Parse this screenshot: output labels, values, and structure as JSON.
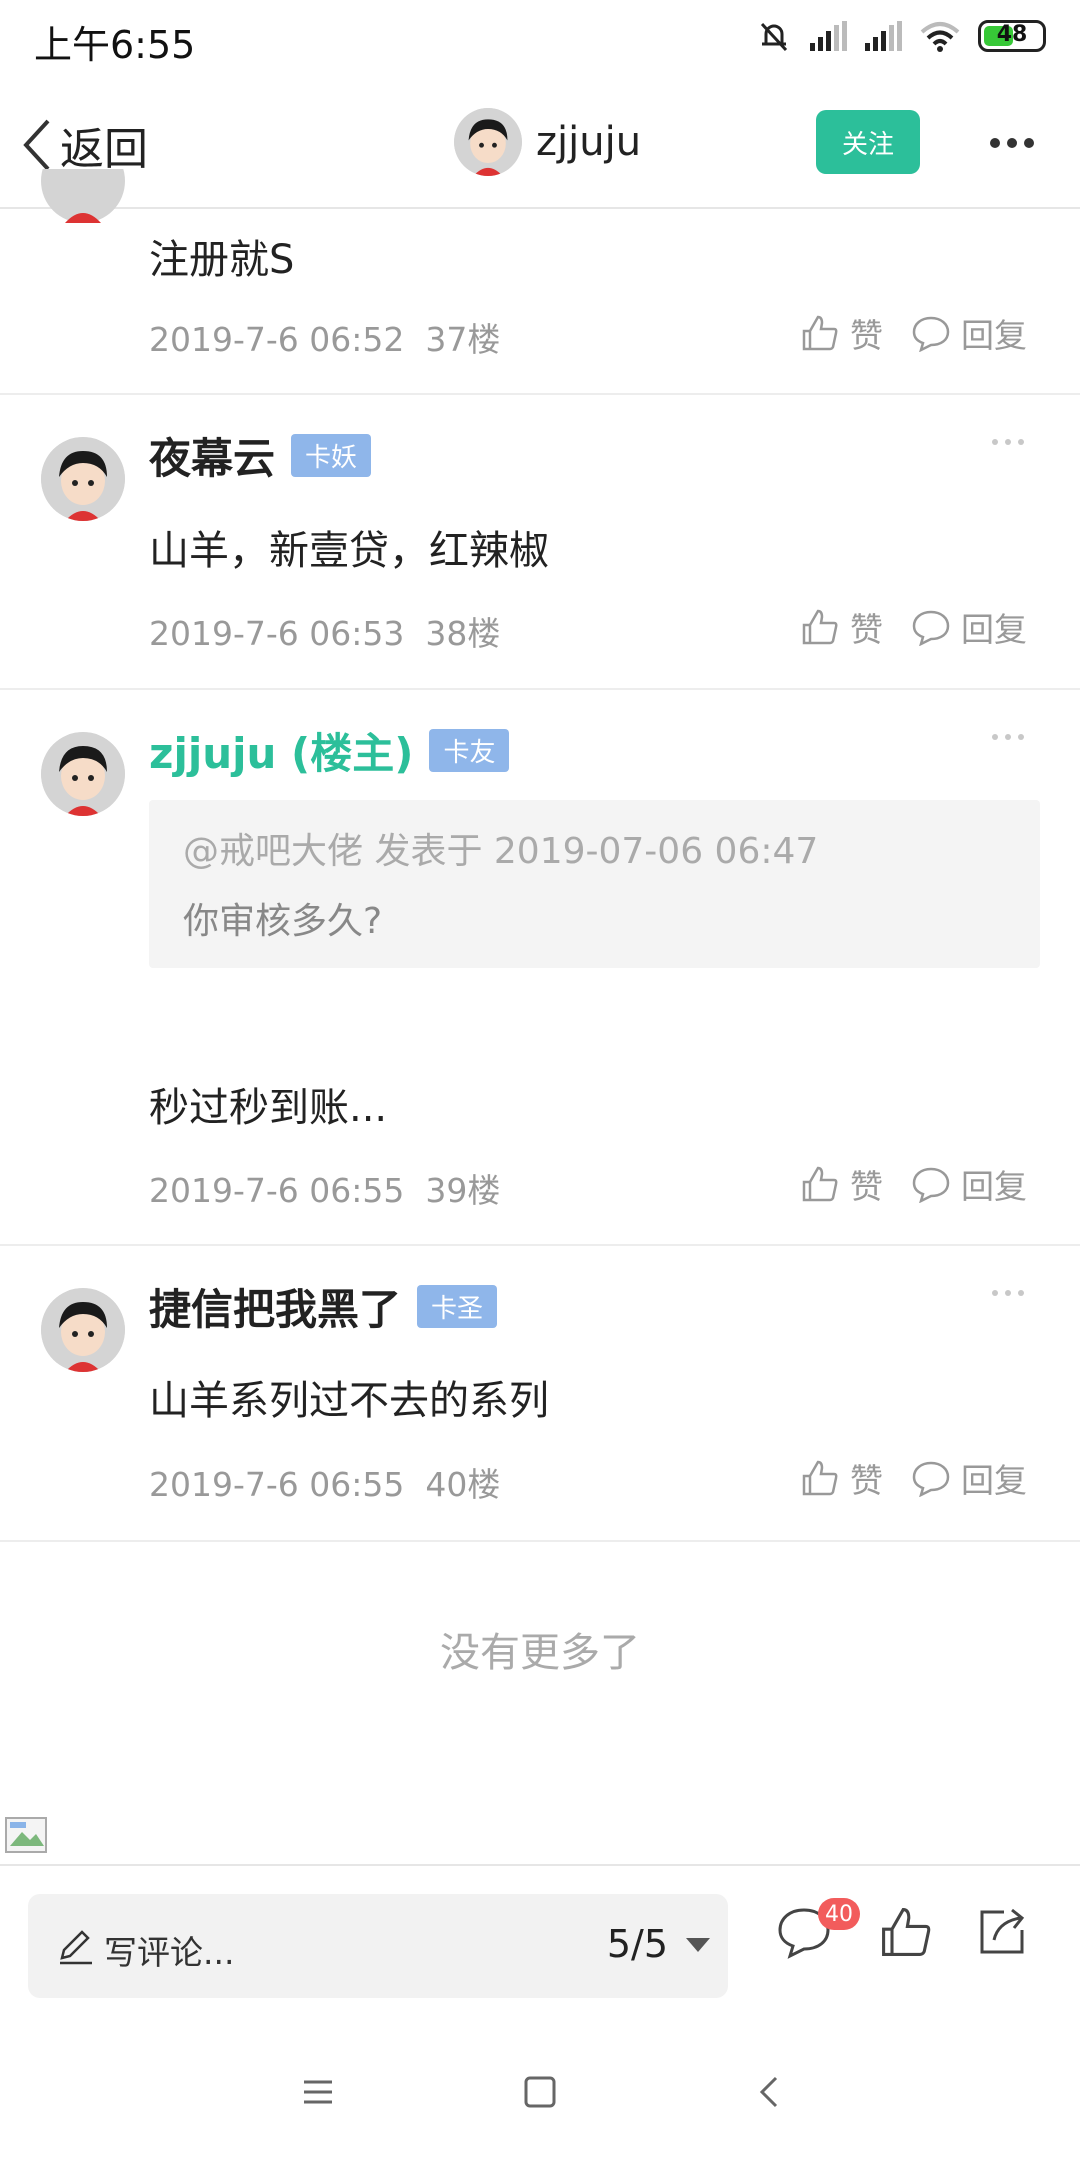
{
  "status": {
    "time": "上午6:55",
    "battery": "48"
  },
  "header": {
    "back_label": "返回",
    "username": "zjjuju",
    "follow_label": "关注"
  },
  "top_partial": {
    "content": "注册就S",
    "date": "2019-7-6 06:52",
    "floor": "37楼",
    "like": "赞",
    "reply": "回复"
  },
  "posts": [
    {
      "username": "夜幕云",
      "badge": "卡妖",
      "content": "山羊，新壹贷，红辣椒",
      "date": "2019-7-6 06:53",
      "floor": "38楼",
      "like": "赞",
      "reply": "回复"
    },
    {
      "username": "zjjuju (楼主)",
      "badge": "卡友",
      "quote_meta": "@戒吧大佬 发表于 2019-07-06 06:47",
      "quote_text": "你审核多久?",
      "content": "秒过秒到账...",
      "date": "2019-7-6 06:55",
      "floor": "39楼",
      "like": "赞",
      "reply": "回复"
    },
    {
      "username": "捷信把我黑了",
      "badge": "卡圣",
      "content": "山羊系列过不去的系列",
      "date": "2019-7-6 06:55",
      "floor": "40楼",
      "like": "赞",
      "reply": "回复"
    }
  ],
  "footer": {
    "no_more": "没有更多了"
  },
  "bottom_bar": {
    "comment_placeholder": "写评论...",
    "page_indicator": "5/5",
    "comment_count": "40"
  },
  "colors": {
    "accent": "#2cbf9a",
    "badge": "#8fb6ea",
    "notify": "#f25c5c"
  },
  "icons": [
    "back-icon",
    "more-icon",
    "thumb-up-icon",
    "reply-bubble-icon",
    "pencil-icon",
    "share-icon",
    "menu-icon",
    "home-icon"
  ]
}
